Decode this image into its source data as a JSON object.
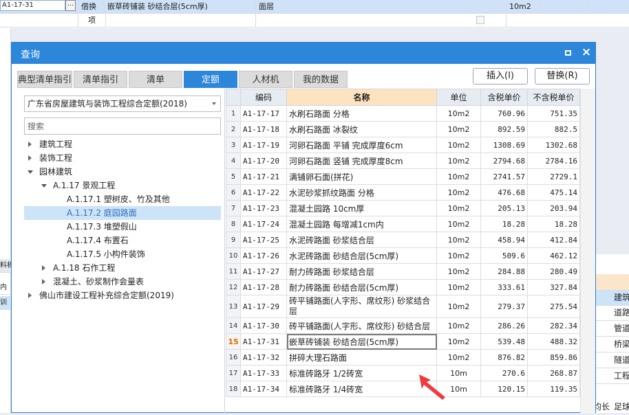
{
  "background": {
    "row1": {
      "code": "A1-17-31",
      "ellipsis": "...",
      "type": "借换",
      "name": "嵌草砖铺装 砂结合层(5cm厚)",
      "feature": "面层",
      "unit": "10m2"
    },
    "row2": {
      "type": "项"
    },
    "left_strip": [
      "",
      "料机",
      "内",
      "训"
    ],
    "right_strip": {
      "header": "",
      "items": [
        "建筑",
        "道路",
        "管道",
        "桥梁",
        "隧道",
        "工程"
      ],
      "footer_left": "均长",
      "footer_right": "足球"
    }
  },
  "dialog": {
    "title": "查询",
    "tabs": [
      {
        "label": "典型清单指引"
      },
      {
        "label": "清单指引"
      },
      {
        "label": "清单"
      },
      {
        "label": "定额"
      },
      {
        "label": "人材机"
      },
      {
        "label": "我的数据"
      }
    ],
    "insert_button": "插入(I)",
    "replace_button": "替换(R)",
    "library_select": "广东省房屋建筑与装饰工程综合定额(2018)",
    "search_placeholder": "搜索",
    "tree": [
      "建筑工程",
      "装饰工程",
      "园林建筑",
      "A.1.17 景观工程",
      "A.1.17.1 塑树皮、竹及其他",
      "A.1.17.2 庭园路面",
      "A.1.17.3 堆塑假山",
      "A.1.17.4 布置石",
      "A.1.17.5 小构件装饰",
      "A.1.18 石作工程",
      "混凝土、砂浆制作会量表",
      "佛山市建设工程补充综合定额(2019)"
    ],
    "table": {
      "headers": [
        "",
        "编码",
        "名称",
        "单位",
        "含税单价",
        "不含税单价"
      ],
      "rows": [
        {
          "idx": "1",
          "code": "A1-17-17",
          "name": "水刷石路面 分格",
          "unit": "10m2",
          "tax": "760.96",
          "notax": "751.35"
        },
        {
          "idx": "2",
          "code": "A1-17-18",
          "name": "水刷石路面 冰裂纹",
          "unit": "10m2",
          "tax": "892.59",
          "notax": "882.5"
        },
        {
          "idx": "3",
          "code": "A1-17-19",
          "name": "河卵石路面 平铺 完成厚度6cm",
          "unit": "10m2",
          "tax": "1308.69",
          "notax": "1302.68"
        },
        {
          "idx": "4",
          "code": "A1-17-20",
          "name": "河卵石路面 竖铺 完成厚度8cm",
          "unit": "10m2",
          "tax": "2794.68",
          "notax": "2784.16"
        },
        {
          "idx": "5",
          "code": "A1-17-21",
          "name": "满铺卵石面(拼花)",
          "unit": "10m2",
          "tax": "2741.57",
          "notax": "2729.1"
        },
        {
          "idx": "6",
          "code": "A1-17-22",
          "name": "水泥砂浆抓纹路面 分格",
          "unit": "10m2",
          "tax": "476.68",
          "notax": "475.14"
        },
        {
          "idx": "7",
          "code": "A1-17-23",
          "name": "混凝土园路 10cm厚",
          "unit": "10m2",
          "tax": "205.13",
          "notax": "203.94"
        },
        {
          "idx": "8",
          "code": "A1-17-24",
          "name": "混凝土园路 每增减1cm内",
          "unit": "10m2",
          "tax": "18.28",
          "notax": "18.28"
        },
        {
          "idx": "9",
          "code": "A1-17-25",
          "name": "水泥砖路面 砂浆结合层",
          "unit": "10m2",
          "tax": "458.94",
          "notax": "412.84"
        },
        {
          "idx": "10",
          "code": "A1-17-26",
          "name": "水泥砖路面 砂结合层(5cm厚)",
          "unit": "10m2",
          "tax": "509.6",
          "notax": "462.12"
        },
        {
          "idx": "11",
          "code": "A1-17-27",
          "name": "耐力砖路面 砂浆结合层",
          "unit": "10m2",
          "tax": "284.88",
          "notax": "280.49"
        },
        {
          "idx": "12",
          "code": "A1-17-28",
          "name": "耐力砖路面 砂结合层(5cm厚)",
          "unit": "10m2",
          "tax": "333.61",
          "notax": "327.84"
        },
        {
          "idx": "13",
          "code": "A1-17-29",
          "name": "砖平铺路面(人字形、席纹形) 砂浆结合层",
          "unit": "10m2",
          "tax": "279.37",
          "notax": "275.54"
        },
        {
          "idx": "14",
          "code": "A1-17-30",
          "name": "砖平铺路面(人字形、席纹形) 砂结合层",
          "unit": "10m2",
          "tax": "286.26",
          "notax": "282.34"
        },
        {
          "idx": "15",
          "code": "A1-17-31",
          "name": "嵌草砖铺装 砂结合层(5cm厚)",
          "unit": "10m2",
          "tax": "539.48",
          "notax": "488.32"
        },
        {
          "idx": "16",
          "code": "A1-17-32",
          "name": "拼碎大理石路面",
          "unit": "10m2",
          "tax": "876.82",
          "notax": "859.86"
        },
        {
          "idx": "17",
          "code": "A1-17-33",
          "name": "标准砖路牙 1/2砖宽",
          "unit": "10m",
          "tax": "270.6",
          "notax": "268.87"
        },
        {
          "idx": "18",
          "code": "A1-17-34",
          "name": "标准砖路牙 1/4砖宽",
          "unit": "10m",
          "tax": "120.15",
          "notax": "119.35"
        }
      ]
    }
  }
}
